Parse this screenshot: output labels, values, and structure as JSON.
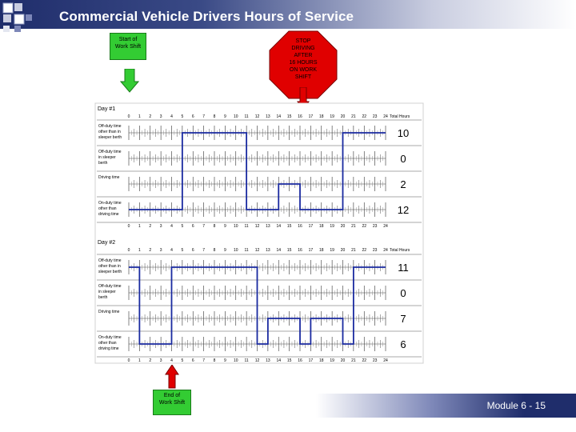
{
  "page": {
    "title": "Commercial Vehicle Drivers Hours of Service",
    "module": "Module 6 -  15"
  },
  "callouts": {
    "start": [
      "Start of",
      "Work Shift"
    ],
    "stop": [
      "STOP",
      "DRIVING",
      "AFTER",
      "16 HOURS",
      "ON WORK",
      "SHIFT"
    ],
    "end": [
      "End of",
      "Work Shift"
    ]
  },
  "colors": {
    "title_bar": "#1f2d6b",
    "callout_green": "#33cc33",
    "stop_red": "#e00000",
    "duty_line": "#1a2aa0"
  },
  "chart_data": [
    {
      "type": "table",
      "title": "Day #1",
      "total_label": "Total Hours",
      "hour_labels": [
        "0",
        "1",
        "2",
        "3",
        "4",
        "5",
        "6",
        "7",
        "8",
        "9",
        "10",
        "11",
        "12",
        "13",
        "14",
        "15",
        "16",
        "17",
        "18",
        "19",
        "20",
        "21",
        "22",
        "23",
        "24"
      ],
      "rows": [
        {
          "label": [
            "Off-duty time",
            "other than in",
            "sleeper berth"
          ],
          "total": "10"
        },
        {
          "label": [
            "Off-duty time",
            "in sleeper",
            "berth"
          ],
          "total": "0"
        },
        {
          "label": [
            "Driving time"
          ],
          "total": "2"
        },
        {
          "label": [
            "On-duty time",
            "other than",
            "driving time"
          ],
          "total": "12"
        }
      ],
      "segments": [
        {
          "from": 0,
          "to": 5,
          "row": 3
        },
        {
          "from": 5,
          "to": 11,
          "row": 0
        },
        {
          "from": 11,
          "to": 14,
          "row": 3
        },
        {
          "from": 14,
          "to": 16,
          "row": 2
        },
        {
          "from": 16,
          "to": 20,
          "row": 3
        },
        {
          "from": 20,
          "to": 24,
          "row": 0
        }
      ]
    },
    {
      "type": "table",
      "title": "Day #2",
      "total_label": "Total Hours",
      "hour_labels": [
        "0",
        "1",
        "2",
        "3",
        "4",
        "5",
        "6",
        "7",
        "8",
        "9",
        "10",
        "11",
        "12",
        "13",
        "14",
        "15",
        "16",
        "17",
        "18",
        "19",
        "20",
        "21",
        "22",
        "23",
        "24"
      ],
      "rows": [
        {
          "label": [
            "Off-duty time",
            "other than in",
            "sleeper berth"
          ],
          "total": "11"
        },
        {
          "label": [
            "Off-duty time",
            "in sleeper",
            "berth"
          ],
          "total": "0"
        },
        {
          "label": [
            "Driving time"
          ],
          "total": "7"
        },
        {
          "label": [
            "On-duty time",
            "other than",
            "driving time"
          ],
          "total": "6"
        }
      ],
      "segments": [
        {
          "from": 0,
          "to": 1,
          "row": 0
        },
        {
          "from": 1,
          "to": 4,
          "row": 3
        },
        {
          "from": 4,
          "to": 12,
          "row": 0
        },
        {
          "from": 12,
          "to": 13,
          "row": 3
        },
        {
          "from": 13,
          "to": 16,
          "row": 2
        },
        {
          "from": 16,
          "to": 17,
          "row": 3
        },
        {
          "from": 17,
          "to": 20,
          "row": 2
        },
        {
          "from": 20,
          "to": 21,
          "row": 3
        },
        {
          "from": 21,
          "to": 24,
          "row": 0
        }
      ]
    }
  ]
}
